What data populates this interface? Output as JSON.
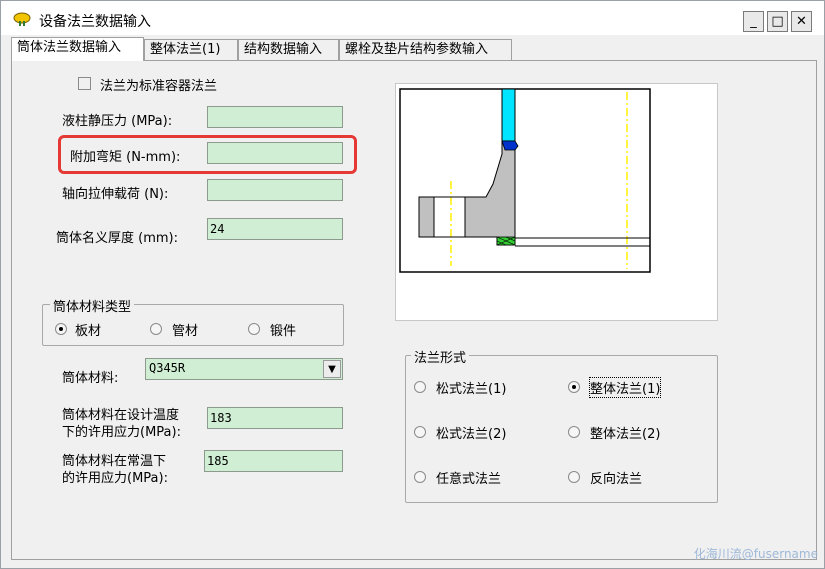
{
  "window": {
    "title": "设备法兰数据输入",
    "minimize_glyph": "_",
    "maximize_glyph": "□",
    "close_glyph": "✕"
  },
  "tabs": [
    {
      "label": "筒体法兰数据输入",
      "active": true
    },
    {
      "label": "整体法兰(1)",
      "active": false
    },
    {
      "label": "结构数据输入",
      "active": false
    },
    {
      "label": "螺栓及垫片结构参数输入",
      "active": false
    }
  ],
  "form": {
    "standard_flange_checkbox": {
      "label": "法兰为标准容器法兰",
      "checked": false
    },
    "hydrostatic_pressure": {
      "label": "液柱静压力 (MPa):",
      "value": ""
    },
    "additional_moment": {
      "label": "附加弯矩 (N-mm):",
      "value": ""
    },
    "axial_tension": {
      "label": "轴向拉伸载荷 (N):",
      "value": ""
    },
    "nominal_thickness": {
      "label": "筒体名义厚度 (mm):",
      "value": "24"
    }
  },
  "material_type_group": {
    "title": "筒体材料类型",
    "options": [
      {
        "label": "板材",
        "selected": true
      },
      {
        "label": "管材",
        "selected": false
      },
      {
        "label": "锻件",
        "selected": false
      }
    ]
  },
  "material": {
    "label": "筒体材料:",
    "value": "Q345R",
    "dropdown_glyph": "▼"
  },
  "design_stress": {
    "label_line1": "筒体材料在设计温度",
    "label_line2": "下的许用应力(MPa):",
    "value": "183"
  },
  "ambient_stress": {
    "label_line1": "筒体材料在常温下",
    "label_line2": "的许用应力(MPa):",
    "value": "185"
  },
  "flange_form_group": {
    "title": "法兰形式",
    "options": [
      {
        "label": "松式法兰(1)",
        "selected": false
      },
      {
        "label": "整体法兰(1)",
        "selected": true
      },
      {
        "label": "松式法兰(2)",
        "selected": false
      },
      {
        "label": "整体法兰(2)",
        "selected": false
      },
      {
        "label": "任意式法兰",
        "selected": false
      },
      {
        "label": "反向法兰",
        "selected": false
      }
    ]
  },
  "colors": {
    "field_bg": "#cfeed3",
    "highlight": "#e53935",
    "shell_cyan": "#00e5ff",
    "flange_gray": "#c0c0c0",
    "weld_blue": "#0033cc",
    "gasket_green": "#33cc33",
    "centerline_yellow": "#ffee00"
  },
  "watermark": "化海川流@fusername"
}
